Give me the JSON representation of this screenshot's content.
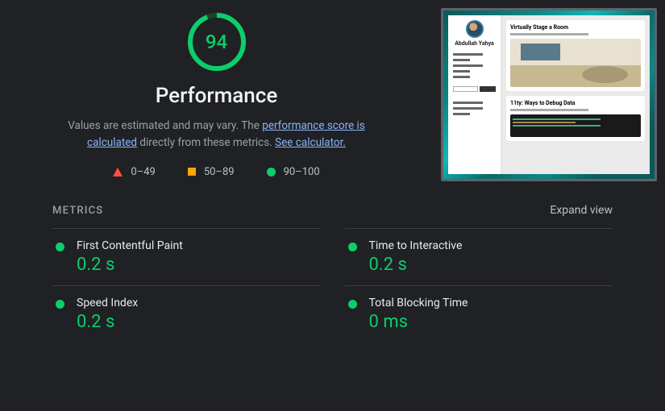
{
  "gauge": {
    "score": 94,
    "max": 100
  },
  "title": "Performance",
  "description": {
    "prefix": "Values are estimated and may vary. The ",
    "link1": "performance score is calculated",
    "mid": " directly from these metrics. ",
    "link2": "See calculator."
  },
  "legend": {
    "fail": "0–49",
    "average": "50–89",
    "pass": "90–100"
  },
  "thumbnail": {
    "profile_name": "Abdullah Yahya",
    "card1_title": "Virtually Stage a Room",
    "card2_title": "11ty: Ways to Debug Data"
  },
  "metrics_header": "METRICS",
  "expand_label": "Expand view",
  "metrics": [
    {
      "name": "First Contentful Paint",
      "value": "0.2 s"
    },
    {
      "name": "Time to Interactive",
      "value": "0.2 s"
    },
    {
      "name": "Speed Index",
      "value": "0.2 s"
    },
    {
      "name": "Total Blocking Time",
      "value": "0 ms"
    }
  ]
}
